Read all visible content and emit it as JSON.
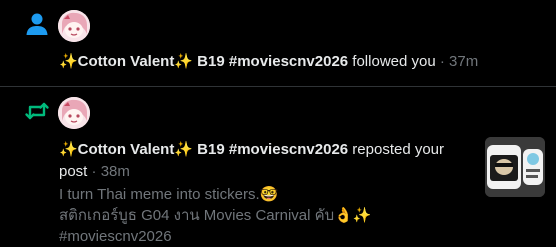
{
  "notifications": [
    {
      "type_icon": "person-icon",
      "display_name": "✨Cotton Valent✨ B19 #moviescnv2026",
      "action": "followed you",
      "separator": "·",
      "time": "37m"
    },
    {
      "type_icon": "repost-icon",
      "display_name": "✨Cotton Valent✨ B19 #moviescnv2026",
      "action_part1": "reposted your",
      "action_part2": "post",
      "separator": "·",
      "time": "38m",
      "post_lines": [
        "I turn Thai meme into stickers.🤓",
        "สติกเกอร์บูธ G04 งาน Movies Carnival คับ👌✨",
        "#moviescnv2026"
      ]
    }
  ],
  "colors": {
    "background": "#000000",
    "text": "#e7e9ea",
    "muted": "#71767b",
    "follow_icon": "#1d9bf0",
    "repost_icon": "#00ba7c",
    "divider": "#2f3336"
  }
}
